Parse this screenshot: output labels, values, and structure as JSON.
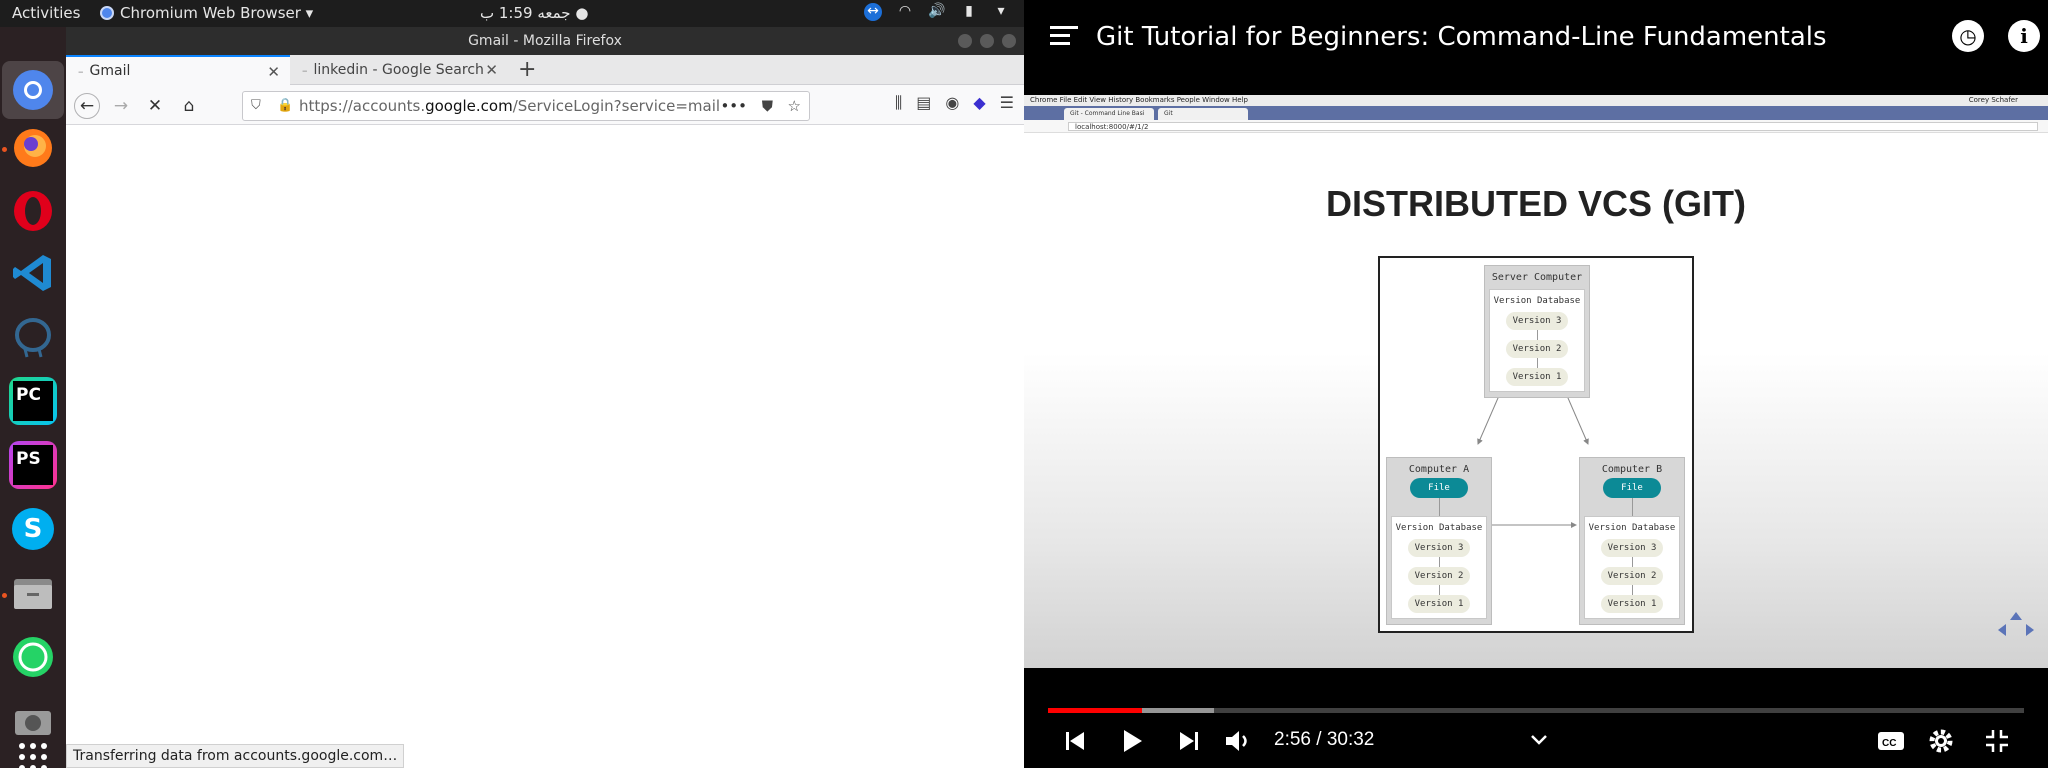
{
  "topbar": {
    "activities": "Activities",
    "app_name": "Chromium Web Browser ▾",
    "clock": "جمعه 1:59 ب ●"
  },
  "dock": {
    "items": [
      "chromium",
      "firefox",
      "opera",
      "vscode",
      "pgadmin",
      "pycharm",
      "phpstorm",
      "skype",
      "files",
      "whatsapp",
      "camera",
      "app-grid"
    ],
    "pycharm_label": "PC",
    "phpstorm_label": "PS",
    "skype_label": "S"
  },
  "firefox": {
    "window_title": "Gmail - Mozilla Firefox",
    "tabs": [
      {
        "label": "Gmail"
      },
      {
        "label": "linkedin - Google Search"
      }
    ],
    "url_prefix": "https://accounts.",
    "url_domain": "google.com",
    "url_rest": "/ServiceLogin?service=mail&pa",
    "status": "Transferring data from accounts.google.com…"
  },
  "youtube": {
    "title": "Git Tutorial for Beginners: Command-Line Fundamentals",
    "time": "2:56 / 30:32",
    "progress_played": 0.0967,
    "progress_buffered": 0.17
  },
  "slide": {
    "mac_menu": "Chrome   File   Edit   View   History   Bookmarks   People   Window   Help",
    "mac_user": "Corey Schafer",
    "mac_tab1": "Git - Command Line Basi",
    "mac_tab2": "Git",
    "mac_url": "localhost:8000/#/1/2",
    "title": "DISTRIBUTED VCS (GIT)",
    "server": {
      "title": "Server Computer",
      "db": "Version Database",
      "versions": [
        "Version 3",
        "Version 2",
        "Version 1"
      ]
    },
    "comp_a": {
      "title": "Computer A",
      "file": "File",
      "db": "Version Database",
      "versions": [
        "Version 3",
        "Version 2",
        "Version 1"
      ]
    },
    "comp_b": {
      "title": "Computer B",
      "file": "File",
      "db": "Version Database",
      "versions": [
        "Version 3",
        "Version 2",
        "Version 1"
      ]
    }
  }
}
